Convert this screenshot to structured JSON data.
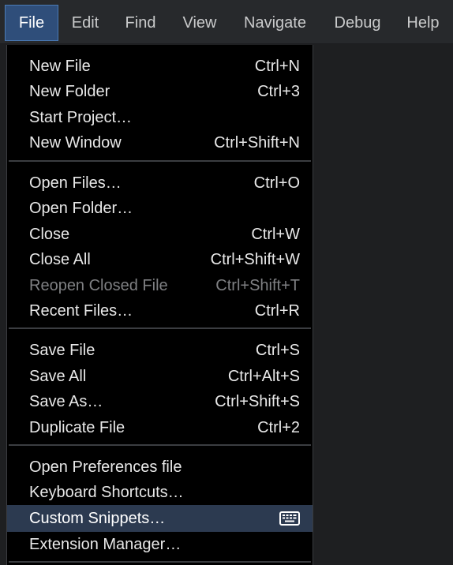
{
  "menubar": {
    "items": [
      "File",
      "Edit",
      "Find",
      "View",
      "Navigate",
      "Debug",
      "Help"
    ],
    "active": "File"
  },
  "file_menu": {
    "groups": [
      [
        {
          "label": "New File",
          "shortcut": "Ctrl+N"
        },
        {
          "label": "New Folder",
          "shortcut": "Ctrl+3"
        },
        {
          "label": "Start Project…",
          "shortcut": ""
        },
        {
          "label": "New Window",
          "shortcut": "Ctrl+Shift+N"
        }
      ],
      [
        {
          "label": "Open Files…",
          "shortcut": "Ctrl+O"
        },
        {
          "label": "Open Folder…",
          "shortcut": ""
        },
        {
          "label": "Close",
          "shortcut": "Ctrl+W"
        },
        {
          "label": "Close All",
          "shortcut": "Ctrl+Shift+W"
        },
        {
          "label": "Reopen Closed File",
          "shortcut": "Ctrl+Shift+T",
          "disabled": true
        },
        {
          "label": "Recent Files…",
          "shortcut": "Ctrl+R"
        }
      ],
      [
        {
          "label": "Save File",
          "shortcut": "Ctrl+S"
        },
        {
          "label": "Save All",
          "shortcut": "Ctrl+Alt+S"
        },
        {
          "label": "Save As…",
          "shortcut": "Ctrl+Shift+S"
        },
        {
          "label": "Duplicate File",
          "shortcut": "Ctrl+2"
        }
      ],
      [
        {
          "label": "Open Preferences file",
          "shortcut": ""
        },
        {
          "label": "Keyboard Shortcuts…",
          "shortcut": ""
        },
        {
          "label": "Custom Snippets…",
          "shortcut": "",
          "icon": "keyboard-icon",
          "highlighted": true
        },
        {
          "label": "Extension Manager…",
          "shortcut": ""
        }
      ]
    ]
  },
  "colors": {
    "menubar_bg": "#27292c",
    "active_menu_bg": "#2f4e7a",
    "dropdown_bg": "#000000",
    "highlight_bg": "#2c3a50",
    "disabled_text": "#7f8083",
    "text": "#e8e8e8"
  }
}
